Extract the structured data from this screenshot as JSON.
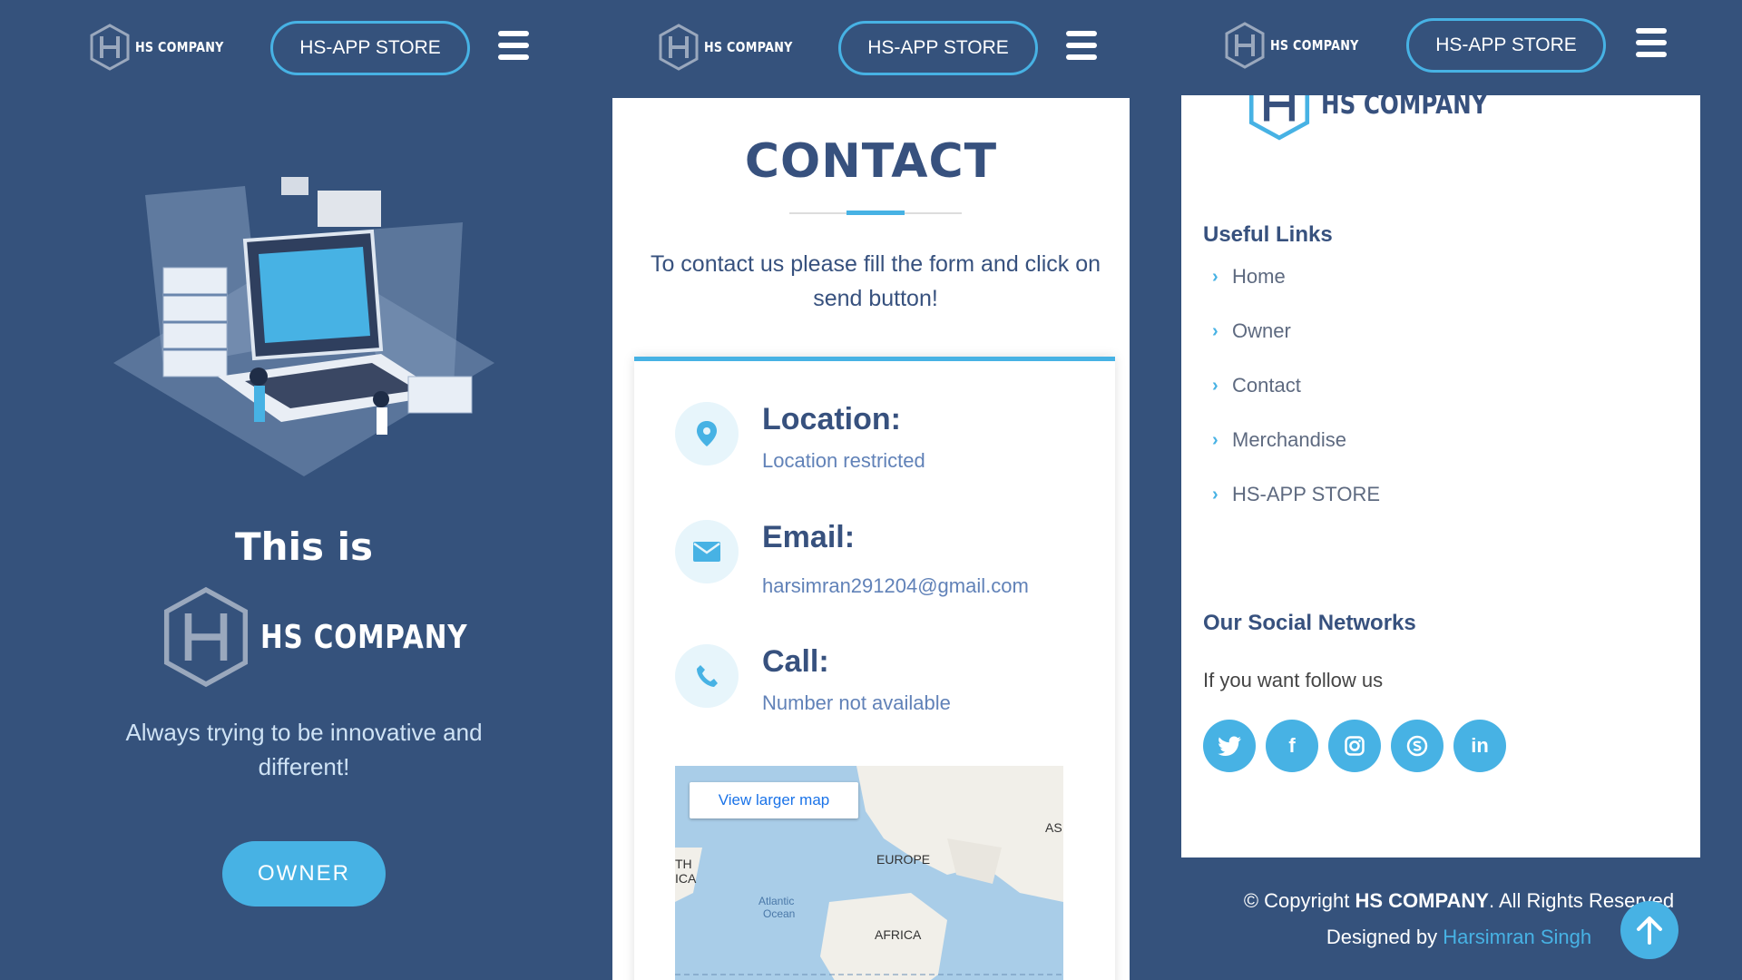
{
  "brand": {
    "name": "HS COMPANY"
  },
  "nav": {
    "store_label": "HS-APP STORE"
  },
  "hero": {
    "title": "This is",
    "logo_text": "HS COMPANY",
    "tagline": "Always trying to be innovative and different!",
    "owner_button": "OWNER"
  },
  "contact": {
    "title": "CONTACT",
    "subtitle": "To contact us please fill the form and click on send button!",
    "items": [
      {
        "label": "Location:",
        "value": "Location restricted",
        "icon": "location-pin-icon"
      },
      {
        "label": "Email:",
        "value": "harsimran291204@gmail.com",
        "icon": "envelope-icon"
      },
      {
        "label": "Call:",
        "value": "Number not available",
        "icon": "phone-icon"
      }
    ],
    "map": {
      "button": "View larger map",
      "labels": [
        "EUROPE",
        "AFRICA",
        "Atlantic",
        "Ocean",
        "AS",
        "TH",
        "ICA"
      ]
    }
  },
  "footer": {
    "logo_text": "HS COMPANY",
    "useful_links_title": "Useful Links",
    "links": [
      "Home",
      "Owner",
      "Contact",
      "Merchandise",
      "HS-APP STORE"
    ],
    "social_title": "Our Social Networks",
    "follow_text": "If you want follow us",
    "socials": [
      "twitter-icon",
      "facebook-icon",
      "instagram-icon",
      "skype-icon",
      "linkedin-icon"
    ],
    "copyright_prefix": "© Copyright",
    "copyright_brand": "HS COMPANY",
    "copyright_suffix": ". All Rights Reserved",
    "designed_prefix": "Designed by",
    "designer": "Harsimran Singh"
  },
  "colors": {
    "background": "#35527c",
    "accent": "#47b2e4",
    "heading": "#37517e"
  }
}
